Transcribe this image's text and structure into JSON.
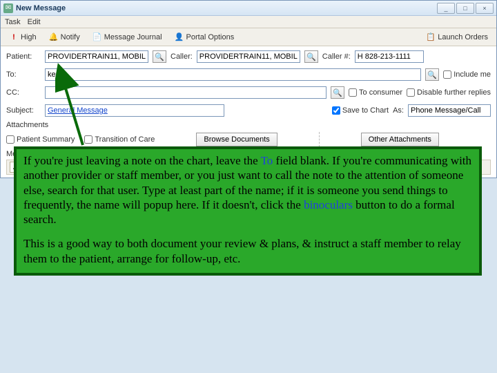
{
  "window": {
    "title": "New Message",
    "min": "_",
    "max": "□",
    "close": "×"
  },
  "menu": {
    "task": "Task",
    "edit": "Edit"
  },
  "toolbar": {
    "high": "High",
    "notify": "Notify",
    "journal": "Message Journal",
    "portal": "Portal Options",
    "launch": "Launch Orders"
  },
  "fields": {
    "patient_lbl": "Patient:",
    "patient_val": "PROVIDERTRAIN11, MOBILE",
    "caller_lbl": "Caller:",
    "caller_val": "PROVIDERTRAIN11, MOBILE",
    "callernum_lbl": "Caller #:",
    "callernum_val": "H 828-213-1111",
    "to_lbl": "To:",
    "to_val": "kener",
    "include_me": "Include me",
    "cc_lbl": "CC:",
    "to_consumer": "To consumer",
    "disable_replies": "Disable further replies",
    "subject_lbl": "Subject:",
    "subject_val": "General Message",
    "save_chart": "Save to Chart",
    "as_lbl": "As:",
    "as_val": "Phone Message/Call"
  },
  "attachments": {
    "label": "Attachments",
    "patient_summary": "Patient Summary",
    "transition": "Transition of Care",
    "browse": "Browse Documents",
    "other": "Other Attachments"
  },
  "message": {
    "label": "Message"
  },
  "overlay": {
    "p1a": "If you're just leaving a note on the chart, leave the ",
    "to_hl": "To",
    "p1b": " field blank.  If you're communicating with another provider or staff member, or you just want to call the note to the attention of someone else, search for that user.  Type at least part of the name; if it is someone you send things to frequently, the name will popup here.  If it doesn't, click the ",
    "bin_hl": "binoculars",
    "p1c": " button to do a formal search.",
    "p2": "This is a good way to both document your review & plans, & instruct a staff member to relay them to the patient, arrange for follow-up, etc."
  }
}
